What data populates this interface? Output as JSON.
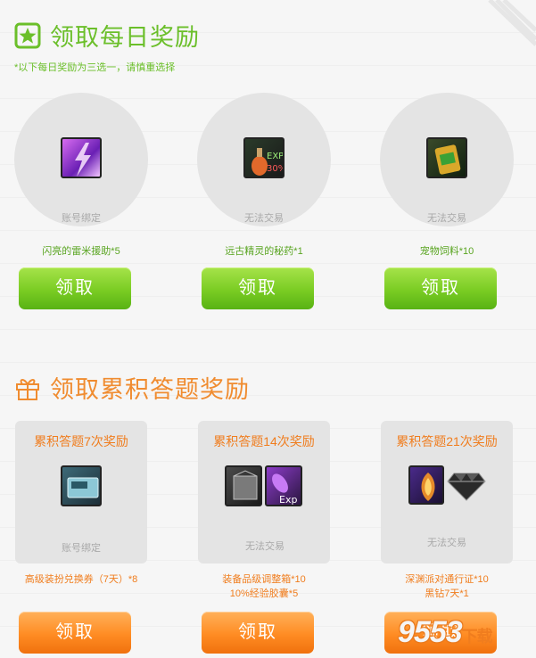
{
  "daily": {
    "title": "领取每日奖励",
    "note": "*以下每日奖励为三选一，请慎重选择",
    "items": [
      {
        "trade": "账号绑定",
        "name": "闪亮的雷米援助*5",
        "button": "领取",
        "icon": "purple-lightning-icon"
      },
      {
        "trade": "无法交易",
        "name": "远古精灵的秘药*1",
        "button": "领取",
        "icon": "exp-potion-icon"
      },
      {
        "trade": "无法交易",
        "name": "宠物饲料*10",
        "button": "领取",
        "icon": "pet-food-icon"
      }
    ]
  },
  "accumulate": {
    "title": "领取累积答题奖励",
    "items": [
      {
        "box_title": "累积答题7次奖励",
        "trade": "账号绑定",
        "name_lines": [
          "高级装扮兑换券（7天）*8"
        ],
        "button": "领取",
        "icons": [
          "voucher-icon"
        ]
      },
      {
        "box_title": "累积答题14次奖励",
        "trade": "无法交易",
        "name_lines": [
          "装备品级调整箱*10",
          "10%经验胶囊*5"
        ],
        "button": "领取",
        "icons": [
          "equipment-box-icon",
          "exp-capsule-icon"
        ]
      },
      {
        "box_title": "累积答题21次奖励",
        "trade": "无法交易",
        "name_lines": [
          "深渊派对通行证*10",
          "黑钻7天*1"
        ],
        "button": "领取",
        "icons": [
          "abyss-pass-icon",
          "black-diamond-icon"
        ]
      }
    ]
  },
  "watermark": {
    "text": "9553",
    "suffix": "下载"
  },
  "colors": {
    "green": "#6bbf2a",
    "orange": "#f08c30",
    "circle": "#e4e4e4"
  }
}
